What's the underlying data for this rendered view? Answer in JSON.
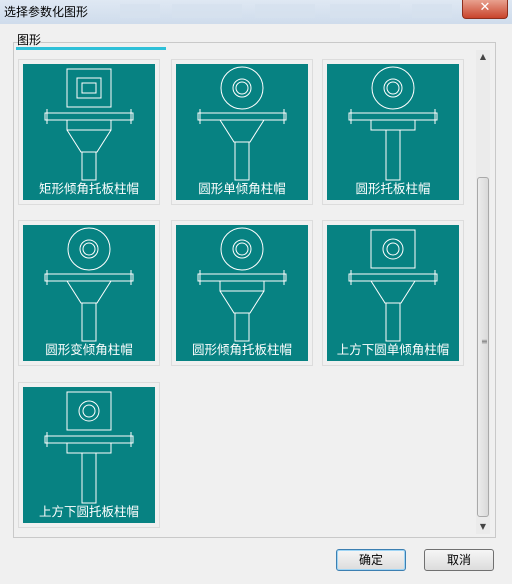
{
  "window": {
    "title": "选择参数化图形",
    "close_glyph": "✕"
  },
  "tab": {
    "label": "图形"
  },
  "tiles": [
    {
      "label": "矩形倾角托板柱帽",
      "top": "square",
      "plate": true,
      "taper": true
    },
    {
      "label": "圆形单倾角柱帽",
      "top": "circle",
      "plate": false,
      "taper": true
    },
    {
      "label": "圆形托板柱帽",
      "top": "circle",
      "plate": true,
      "taper": false
    },
    {
      "label": "圆形变倾角柱帽",
      "top": "circle",
      "plate": false,
      "taper": true
    },
    {
      "label": "圆形倾角托板柱帽",
      "top": "circle",
      "plate": true,
      "taper": true
    },
    {
      "label": "上方下圆单倾角柱帽",
      "top": "square-circle",
      "plate": false,
      "taper": true
    },
    {
      "label": "上方下圆托板柱帽",
      "top": "square-circle",
      "plate": true,
      "taper": false
    }
  ],
  "buttons": {
    "ok": "确定",
    "cancel": "取消"
  },
  "colors": {
    "tile_bg": "#078282",
    "line": "#ffffff",
    "tab_accent": "#2ec0d8"
  }
}
